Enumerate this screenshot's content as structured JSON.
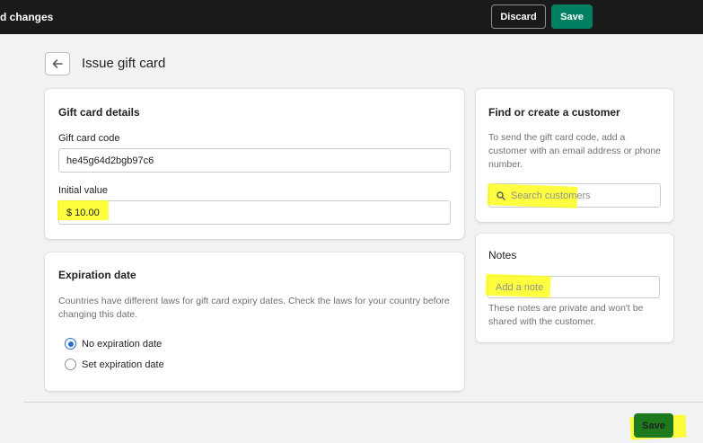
{
  "topbar": {
    "title": "d changes",
    "discard_label": "Discard",
    "save_label": "Save"
  },
  "header": {
    "back_icon": "arrow-left-icon",
    "title": "Issue gift card"
  },
  "gift_card_details": {
    "title": "Gift card details",
    "code_label": "Gift card code",
    "code_value": "he45g64d2bgb97c6",
    "initial_value_label": "Initial value",
    "initial_value": "$ 10.00"
  },
  "expiration": {
    "title": "Expiration date",
    "help": "Countries have different laws for gift card expiry dates. Check the laws for your country before changing this date.",
    "options": [
      {
        "label": "No expiration date",
        "checked": true
      },
      {
        "label": "Set expiration date",
        "checked": false
      }
    ]
  },
  "customer": {
    "title": "Find or create a customer",
    "help": "To send the gift card code, add a customer with an email address or phone number.",
    "search_placeholder": "Search customers",
    "search_icon": "search-icon"
  },
  "notes": {
    "title": "Notes",
    "placeholder": "Add a note",
    "help": "These notes are private and won't be shared with the customer."
  },
  "footer": {
    "save_label": "Save"
  },
  "colors": {
    "topbar": "#1a1a1a",
    "primary": "#008060",
    "highlight": "#ffff00",
    "radio_accent": "#2c6ecb"
  }
}
